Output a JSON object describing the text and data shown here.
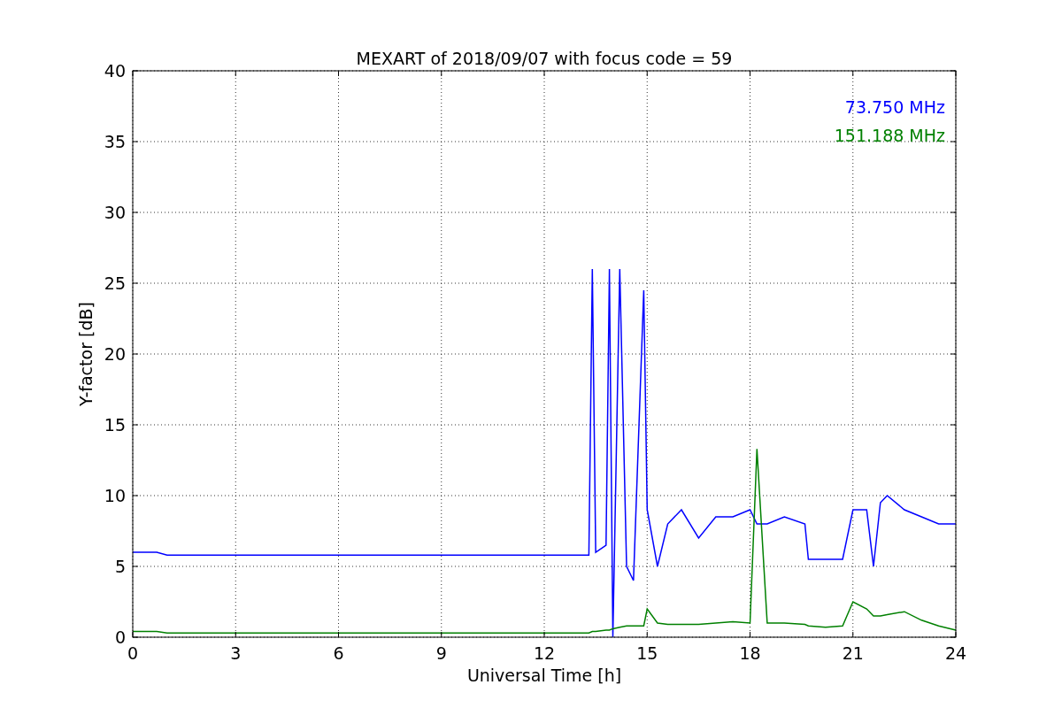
{
  "chart_data": {
    "type": "line",
    "title": "MEXART of 2018/09/07 with focus code = 59",
    "xlabel": "Universal Time [h]",
    "ylabel": "Y-factor [dB]",
    "x": [
      0,
      0.7,
      1,
      3,
      6,
      9,
      12,
      13.3,
      13.4,
      13.5,
      13.8,
      13.9,
      14.0,
      14.2,
      14.4,
      14.6,
      14.9,
      15.0,
      15.3,
      15.6,
      16,
      16.5,
      17,
      17.5,
      18,
      18.2,
      18.5,
      19,
      19.6,
      19.7,
      20.2,
      20.7,
      21,
      21.4,
      21.6,
      21.8,
      22,
      22.5,
      23,
      23.5,
      24
    ],
    "series": [
      {
        "name": "73.750 MHz",
        "color": "#0000ff",
        "values": [
          6,
          6,
          5.8,
          5.8,
          5.8,
          5.8,
          5.8,
          5.8,
          26,
          6,
          6.5,
          26,
          0,
          26,
          5,
          4,
          24.5,
          9,
          5,
          8,
          9,
          7,
          8.5,
          8.5,
          9,
          8,
          8,
          8.5,
          8,
          5.5,
          5.5,
          5.5,
          9,
          9,
          5,
          9.5,
          10,
          9,
          8.5,
          8,
          8
        ]
      },
      {
        "name": "151.188 MHz",
        "color": "#008000",
        "values": [
          0.4,
          0.4,
          0.3,
          0.3,
          0.3,
          0.3,
          0.3,
          0.3,
          0.4,
          0.4,
          0.5,
          0.5,
          0.6,
          0.7,
          0.8,
          0.8,
          0.8,
          2,
          1,
          0.9,
          0.9,
          0.9,
          1,
          1.1,
          1,
          13.3,
          1,
          1,
          0.9,
          0.8,
          0.7,
          0.8,
          2.5,
          2,
          1.5,
          1.5,
          1.6,
          1.8,
          1.2,
          0.8,
          0.5
        ]
      }
    ],
    "grid": true,
    "xlim": [
      0,
      24
    ],
    "ylim": [
      0,
      40
    ],
    "xticks": [
      0,
      3,
      6,
      9,
      12,
      15,
      18,
      21,
      24
    ],
    "yticks": [
      0,
      5,
      10,
      15,
      20,
      25,
      30,
      35,
      40
    ]
  }
}
